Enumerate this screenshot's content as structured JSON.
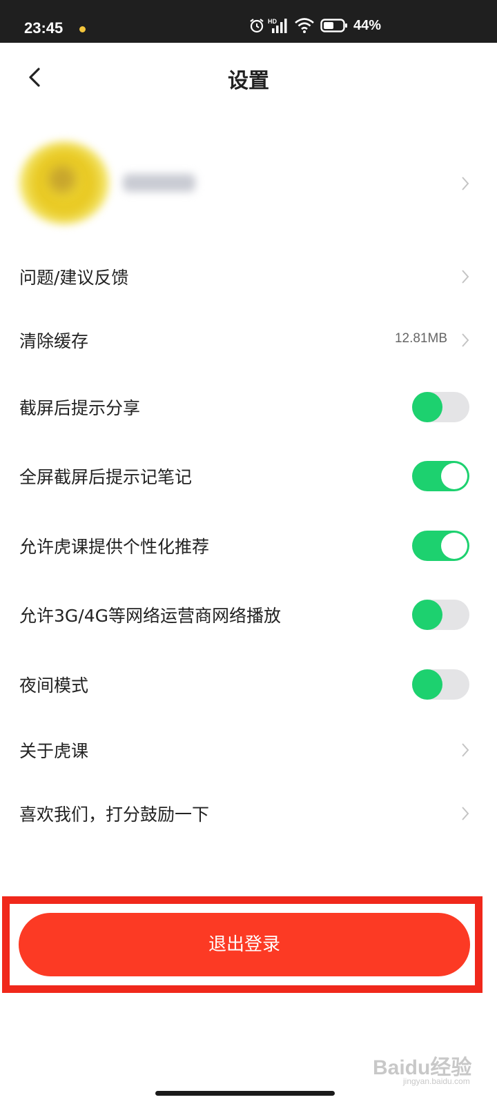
{
  "status_bar": {
    "time": "23:45",
    "network_badge": "HD",
    "battery_percent": "44%",
    "icons": [
      "alarm-icon",
      "signal-icon",
      "wifi-icon",
      "battery-icon"
    ]
  },
  "header": {
    "title": "设置"
  },
  "settings": {
    "feedback": {
      "label": "问题/建议反馈"
    },
    "clear_cache": {
      "label": "清除缓存",
      "value": "12.81MB"
    },
    "screenshot_share": {
      "label": "截屏后提示分享",
      "enabled": false
    },
    "fullscreen_notes": {
      "label": "全屏截屏后提示记笔记",
      "enabled": true
    },
    "personalized": {
      "label": "允许虎课提供个性化推荐",
      "enabled": true
    },
    "mobile_network": {
      "label": "允许3G/4G等网络运营商网络播放",
      "enabled": false
    },
    "night_mode": {
      "label": "夜间模式",
      "enabled": false
    },
    "about": {
      "label": "关于虎课"
    },
    "rate": {
      "label": "喜欢我们，打分鼓励一下"
    }
  },
  "logout": {
    "label": "退出登录"
  },
  "watermark": {
    "brand": "Baidu经验",
    "sub": "jingyan.baidu.com"
  },
  "colors": {
    "toggle_on": "#1dd16f",
    "toggle_off": "#e4e4e6",
    "logout_button": "#fc3a24",
    "highlight_box": "#f0281b"
  }
}
